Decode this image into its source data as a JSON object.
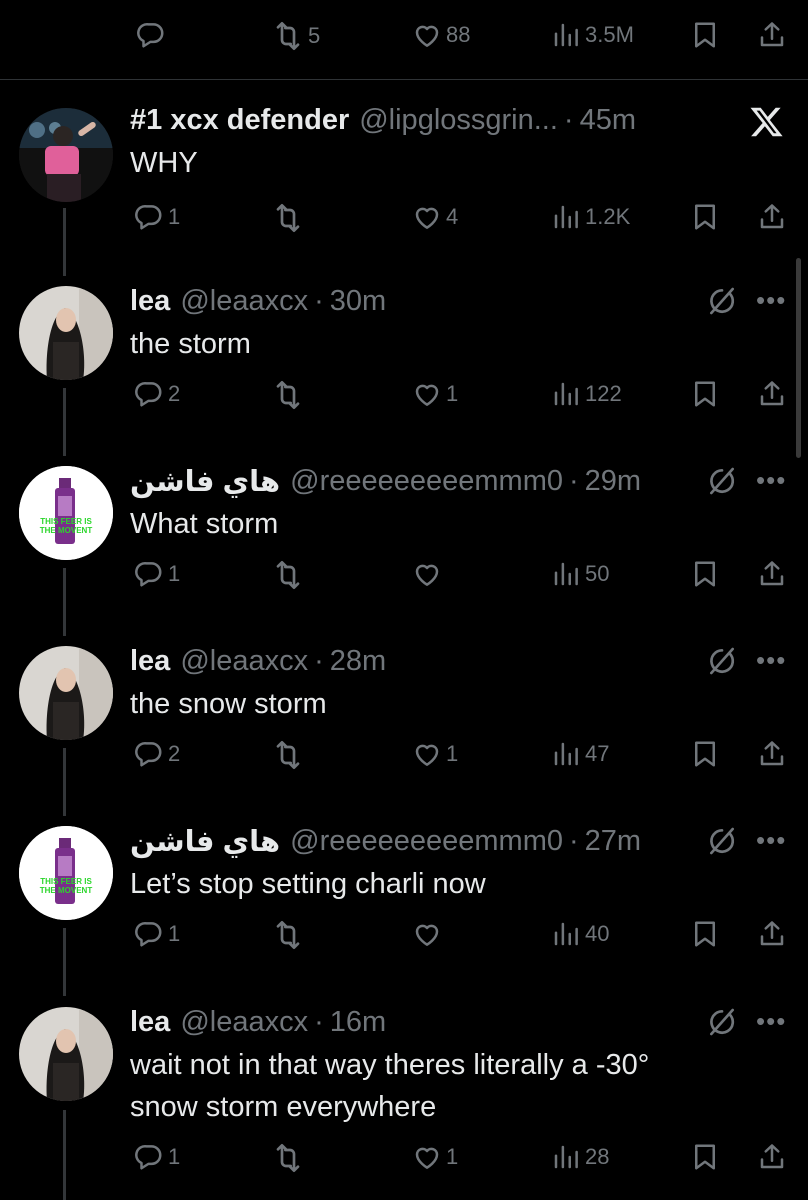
{
  "top_actions": {
    "retweets": "5",
    "likes": "88",
    "views": "3.5M"
  },
  "tweets": [
    {
      "name": "#1 xcx defender",
      "handle": "@lipglossgrin...",
      "time": "45m",
      "text": "WHY",
      "replies": "1",
      "retweets": "",
      "likes": "4",
      "views": "1.2K",
      "corner_icon": "x-logo-icon"
    },
    {
      "name": "lea",
      "handle": "@leaaxcx",
      "time": "30m",
      "text": "the storm",
      "replies": "2",
      "retweets": "",
      "likes": "1",
      "views": "122",
      "corner_icon": "grok-icon"
    },
    {
      "name": "هاي فاشن",
      "handle": "@reeeeeeeeemmm0",
      "time": "29m",
      "text": "What storm",
      "replies": "1",
      "retweets": "",
      "likes": "",
      "views": "50",
      "corner_icon": "grok-icon"
    },
    {
      "name": "lea",
      "handle": "@leaaxcx",
      "time": "28m",
      "text": "the snow storm",
      "replies": "2",
      "retweets": "",
      "likes": "1",
      "views": "47",
      "corner_icon": "grok-icon"
    },
    {
      "name": "هاي فاشن",
      "handle": "@reeeeeeeeemmm0",
      "time": "27m",
      "text": "Let’s stop setting charli now",
      "replies": "1",
      "retweets": "",
      "likes": "",
      "views": "40",
      "corner_icon": "grok-icon"
    },
    {
      "name": "lea",
      "handle": "@leaaxcx",
      "time": "16m",
      "text_line1": "wait not in that way theres literally a -30°",
      "text_line2": "snow storm everywhere",
      "replies": "1",
      "retweets": "",
      "likes": "1",
      "views": "28",
      "corner_icon": "grok-icon"
    }
  ],
  "avatar_text": {
    "line1": "THIS FEER IS",
    "line2": "THE MOVENT"
  },
  "colors": {
    "background": "#000000",
    "text": "#e7e9ea",
    "muted": "#71767b",
    "thread_line": "#333639",
    "avatar_green_text": "#2bd62b"
  }
}
